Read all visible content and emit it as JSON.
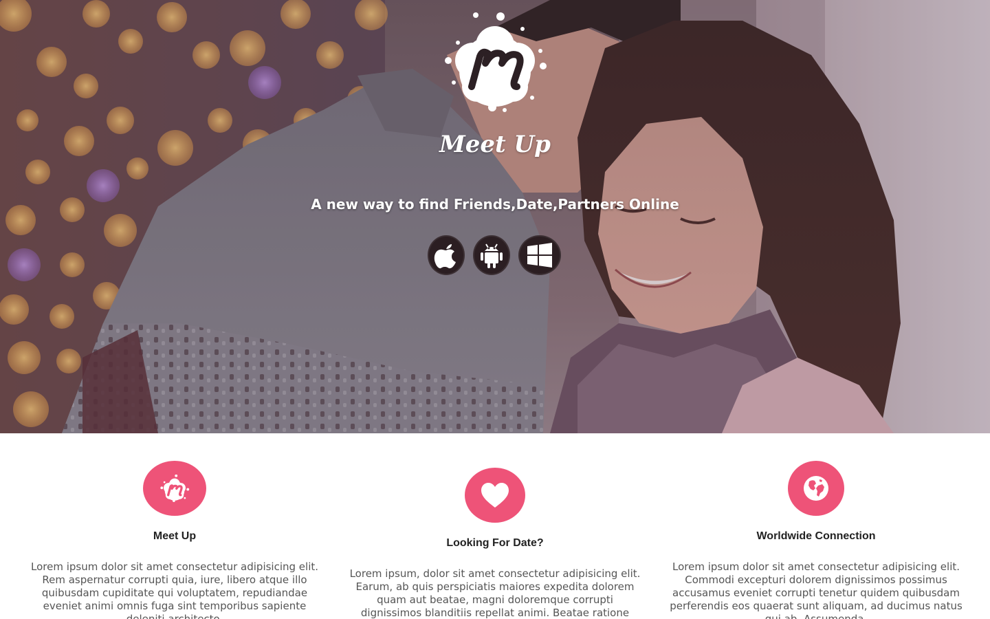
{
  "hero": {
    "brand": "Meet Up",
    "tagline": "A new way to find Friends,Date,Partners Online",
    "stores": [
      {
        "icon": "apple-icon",
        "platform": "iOS"
      },
      {
        "icon": "android-icon",
        "platform": "Android"
      },
      {
        "icon": "windows-icon",
        "platform": "Windows"
      }
    ]
  },
  "features": [
    {
      "icon": "meetup-logo-icon",
      "title": "Meet Up",
      "body": "Lorem ipsum dolor sit amet consectetur adipisicing elit. Rem aspernatur corrupti quia, iure, libero atque illo quibusdam cupiditate qui voluptatem, repudiandae eveniet animi omnis fuga sint temporibus sapiente deleniti architecto."
    },
    {
      "icon": "heart-icon",
      "title": "Looking For Date?",
      "body": "Lorem ipsum, dolor sit amet consectetur adipisicing elit. Earum, ab quis perspiciatis maiores expedita dolorem quam aut beatae, magni doloremque corrupti dignissimos blanditiis repellat animi. Beatae ratione unde libero vel!"
    },
    {
      "icon": "globe-icon",
      "title": "Worldwide Connection",
      "body": "Lorem ipsum dolor sit amet consectetur adipisicing elit. Commodi excepturi dolorem dignissimos possimus accusamus eveniet corrupti tenetur quidem quibusdam perferendis eos quaerat sunt aliquam, ad ducimus natus qui ab. Assumenda."
    }
  ],
  "colors": {
    "accent": "#ee5378",
    "store_button": "#2b1e22",
    "hero_text": "#ffffff",
    "body_text": "#555555",
    "heading_text": "#222222"
  }
}
